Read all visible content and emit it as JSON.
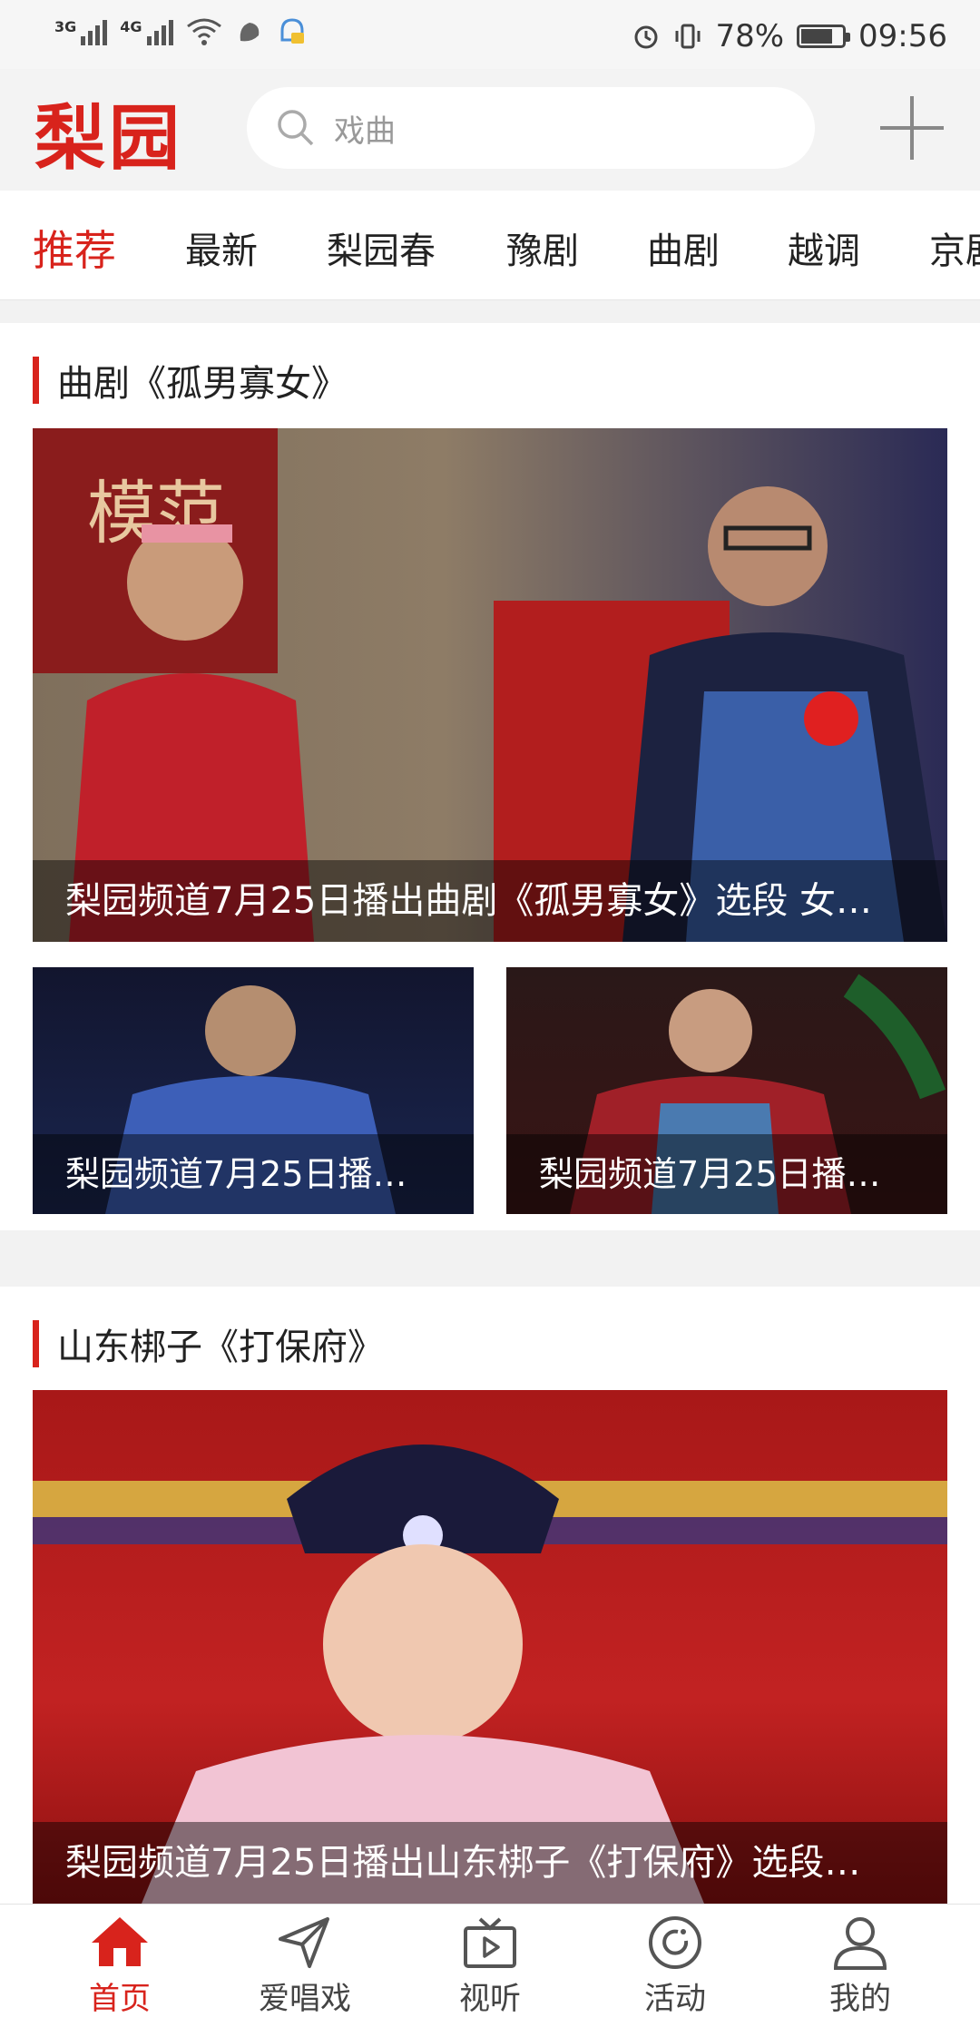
{
  "status": {
    "net1": "3G",
    "net2": "4G",
    "battery": "78%",
    "battery_level": 0.78,
    "time": "09:56"
  },
  "header": {
    "logo": "梨园",
    "search_placeholder": "戏曲"
  },
  "tabs": [
    "推荐",
    "最新",
    "梨园春",
    "豫剧",
    "曲剧",
    "越调",
    "京剧"
  ],
  "sections": [
    {
      "title": "曲剧《孤男寡女》",
      "main": "梨园频道7月25日播出曲剧《孤男寡女》选段 女…",
      "subs": [
        "梨园频道7月25日播…",
        "梨园频道7月25日播…"
      ]
    },
    {
      "title": "山东梆子《打保府》",
      "main": "梨园频道7月25日播出山东梆子《打保府》选段…"
    }
  ],
  "nav": [
    "首页",
    "爱唱戏",
    "视听",
    "活动",
    "我的"
  ],
  "colors": {
    "accent": "#d8231c"
  }
}
